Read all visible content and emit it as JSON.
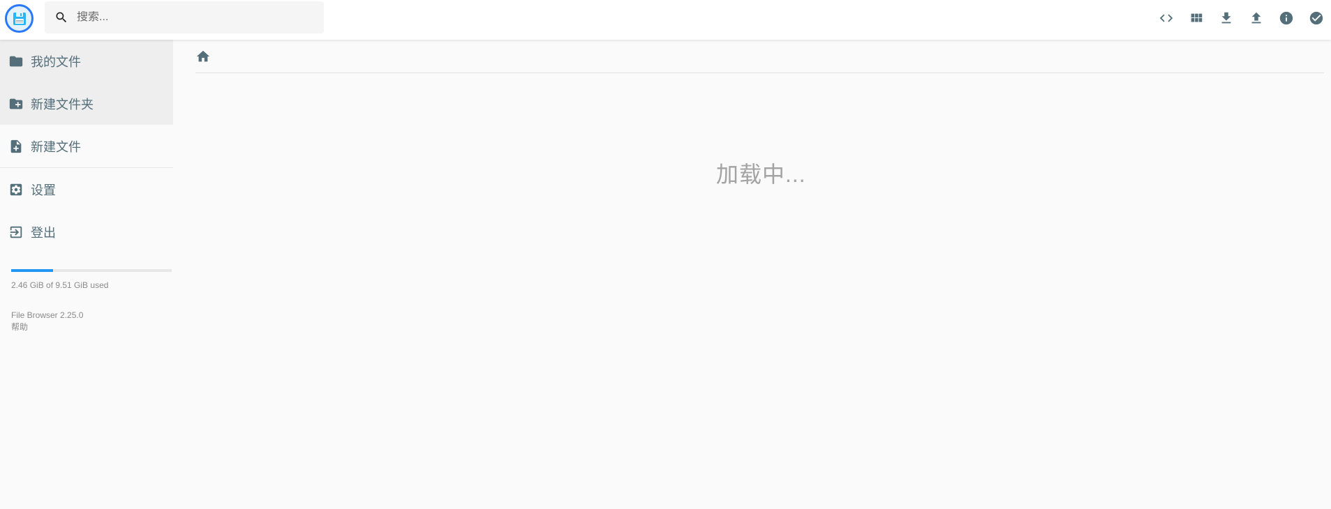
{
  "header": {
    "search_placeholder": "搜索...",
    "actions": [
      {
        "name": "toggle-code-button",
        "icon": "code-icon"
      },
      {
        "name": "switch-view-button",
        "icon": "grid-icon"
      },
      {
        "name": "download-button",
        "icon": "download-icon"
      },
      {
        "name": "upload-button",
        "icon": "upload-icon"
      },
      {
        "name": "info-button",
        "icon": "info-icon"
      },
      {
        "name": "select-button",
        "icon": "check-circle-icon"
      }
    ]
  },
  "sidebar": {
    "items": [
      {
        "label": "我的文件",
        "icon": "folder-icon"
      },
      {
        "label": "新建文件夹",
        "icon": "create-folder-icon"
      },
      {
        "label": "新建文件",
        "icon": "note-add-icon"
      },
      {
        "label": "设置",
        "icon": "settings-icon"
      },
      {
        "label": "登出",
        "icon": "exit-icon"
      }
    ],
    "quota": {
      "text": "2.46 GiB of 9.51 GiB used",
      "used_fraction": 0.259
    },
    "credits": {
      "version": "File Browser 2.25.0",
      "help": "帮助"
    }
  },
  "main": {
    "breadcrumb_icon": "home-icon",
    "loading_text": "加载中..."
  },
  "colors": {
    "accent": "#2196f3",
    "icon": "#546e7a",
    "background": "#fafafa"
  }
}
